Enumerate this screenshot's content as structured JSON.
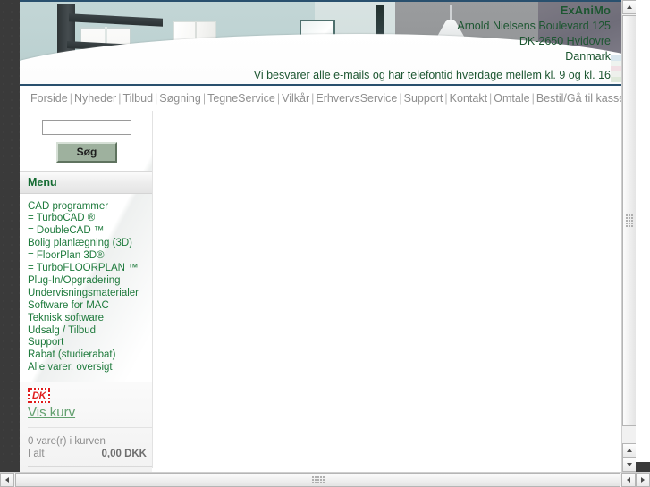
{
  "banner": {
    "company": "ExAniMo",
    "address_line1": "Arnold Nielsens Boulevard 125",
    "address_line2": "DK-2650 Hvidovre",
    "address_line3": "Danmark",
    "tagline": "Vi besvarer alle e-mails og har telefontid hverdage mellem kl. 9 og kl. 16",
    "accent_color": "#1d5631",
    "rule_color": "#29506e"
  },
  "nav": {
    "separator": "|",
    "items": [
      "Forside",
      "Nyheder",
      "Tilbud",
      "Søgning",
      "TegneService",
      "Vilkår",
      "ErhvervsService",
      "Support",
      "Kontakt",
      "Omtale",
      "Bestil/Gå til kassen"
    ]
  },
  "search": {
    "value": "",
    "placeholder": "",
    "button_label": "Søg"
  },
  "menu": {
    "heading": "Menu",
    "items": [
      "CAD programmer",
      "= TurboCAD ®",
      "= DoubleCAD ™",
      "Bolig planlægning (3D)",
      "= FloorPlan 3D®",
      "= TurboFLOORPLAN ™",
      "Plug-In/Opgradering",
      "Undervisningsmaterialer",
      "Software for MAC",
      "Teknisk software",
      "Udsalg / Tilbud",
      "Support",
      "Rabat (studierabat)",
      "Alle varer, oversigt"
    ],
    "link_color": "#1e7a3c",
    "heading_color": "#146b32"
  },
  "cart": {
    "logo_text": "DK",
    "logo_color": "#e01b1b",
    "view_cart_label": "Vis kurv",
    "item_count_text": "0 vare(r) i kurven",
    "total_label": "I alt",
    "total_value": "0,00 DKK"
  },
  "scrollbars": {
    "vertical_up": "▲",
    "vertical_down": "▼",
    "horizontal_left": "◀",
    "horizontal_right": "▶"
  }
}
